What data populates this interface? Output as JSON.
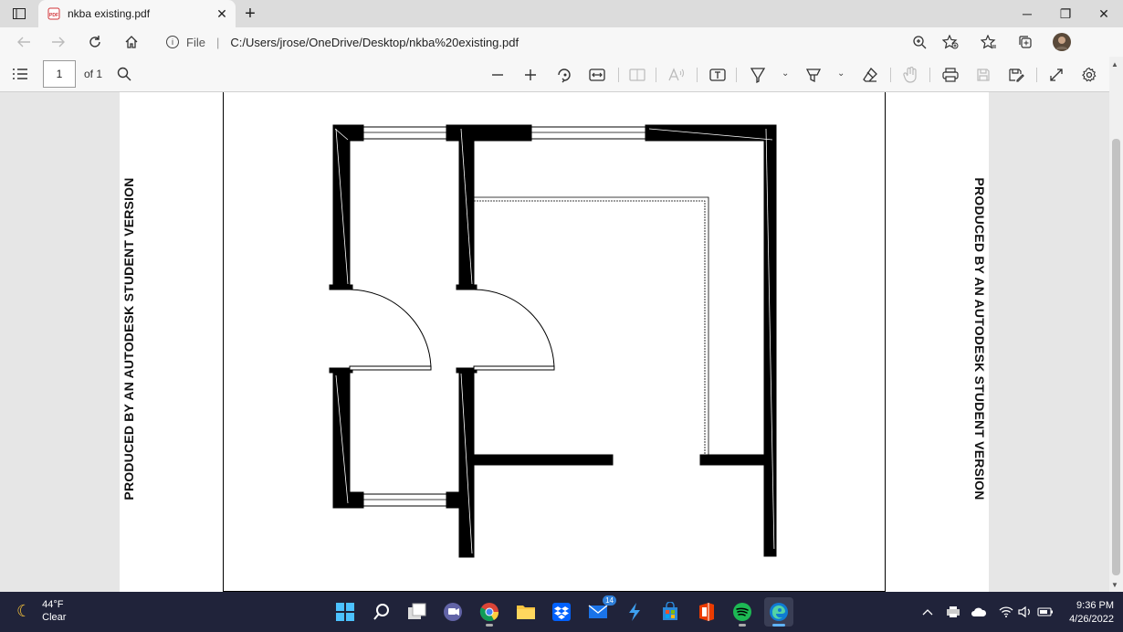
{
  "browser": {
    "tab_title": "nkba existing.pdf",
    "tab_close": "✕",
    "new_tab": "+",
    "window": {
      "minimize": "─",
      "maximize": "❐",
      "close": "✕"
    }
  },
  "address": {
    "file_label": "File",
    "separator": "|",
    "url": "C:/Users/jrose/OneDrive/Desktop/nkba%20existing.pdf"
  },
  "pdf_toolbar": {
    "page_number": "1",
    "page_of": "of 1"
  },
  "document": {
    "watermark_left": "PRODUCED BY AN AUTODESK STUDENT VERSION",
    "watermark_right": "PRODUCED BY AN AUTODESK STUDENT VERSION"
  },
  "taskbar": {
    "weather_temp": "44°F",
    "weather_desc": "Clear",
    "mail_badge": "14",
    "time": "9:36 PM",
    "date": "4/26/2022"
  },
  "colors": {
    "accent": "#0078d4",
    "taskbar_bg": "#20233a",
    "toolbar_bg": "#f7f7f7",
    "pdf_icon_red": "#d13438"
  }
}
